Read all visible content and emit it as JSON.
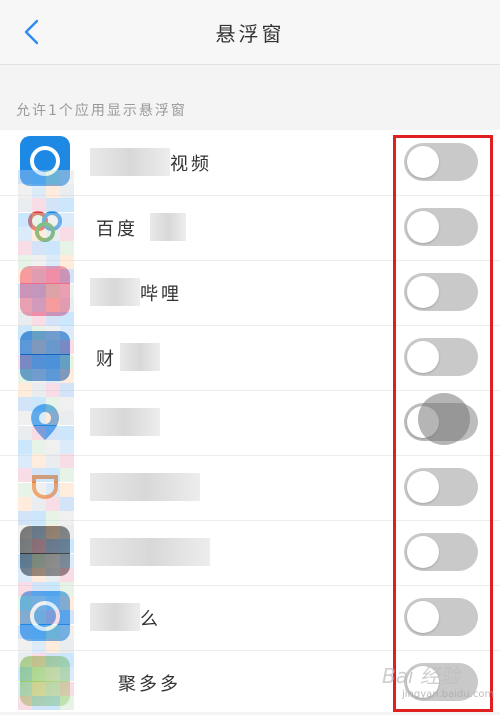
{
  "header": {
    "title": "悬浮窗",
    "back_icon": "chevron-left-icon",
    "accent_color": "#2d8cf0"
  },
  "section": {
    "label": "允许1个应用显示悬浮窗"
  },
  "apps": [
    {
      "name": "视频",
      "icon": "blue-video-app-icon",
      "icon_color": "#1e88e5",
      "toggle": "off"
    },
    {
      "name": "百度",
      "icon": "baidu-app-icon",
      "icon_color": "#2196f3",
      "toggle": "off"
    },
    {
      "name": "哔哩",
      "icon": "pink-app-icon",
      "icon_color": "#ef6c8c",
      "toggle": "off"
    },
    {
      "name": "财",
      "icon": "blue-app-icon",
      "icon_color": "#1565c0",
      "toggle": "off"
    },
    {
      "name": "",
      "icon": "location-app-icon",
      "icon_color": "#1e88e5",
      "toggle": "off"
    },
    {
      "name": "",
      "icon": "orange-app-icon",
      "icon_color": "#ff7a1a",
      "toggle": "off"
    },
    {
      "name": "",
      "icon": "dark-app-icon",
      "icon_color": "#333333",
      "toggle": "off"
    },
    {
      "name": "么",
      "icon": "blue-round-app-icon",
      "icon_color": "#1e88e5",
      "toggle": "off"
    },
    {
      "name": "聚多多",
      "icon": "green-app-icon",
      "icon_color": "#8bc34a",
      "toggle": "off"
    }
  ],
  "highlight_color": "#e02020",
  "watermark": {
    "text": "Bai 经验",
    "sub": "jingyan.baidu.com"
  }
}
